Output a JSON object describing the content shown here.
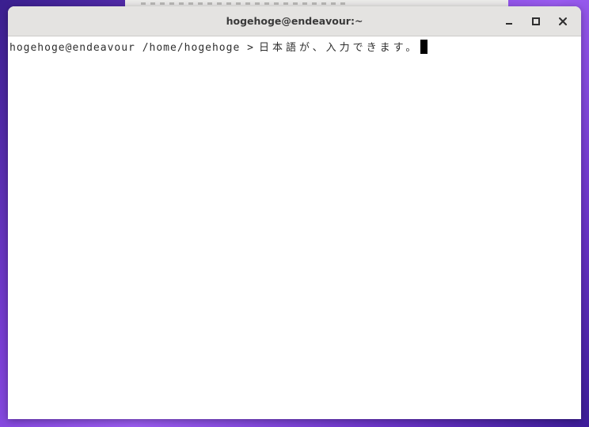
{
  "window": {
    "title": "hogehoge@endeavour:~"
  },
  "controls": {
    "minimize_icon": "minimize-icon",
    "maximize_icon": "maximize-icon",
    "close_icon": "close-icon"
  },
  "terminal": {
    "prompt": "hogehoge@endeavour /home/hogehoge >",
    "input": "日本語が、入力できます。"
  },
  "colors": {
    "titlebar": "#e4e3e1",
    "terminal_bg": "#ffffff",
    "text": "#2e2e2e",
    "cursor": "#000000"
  }
}
